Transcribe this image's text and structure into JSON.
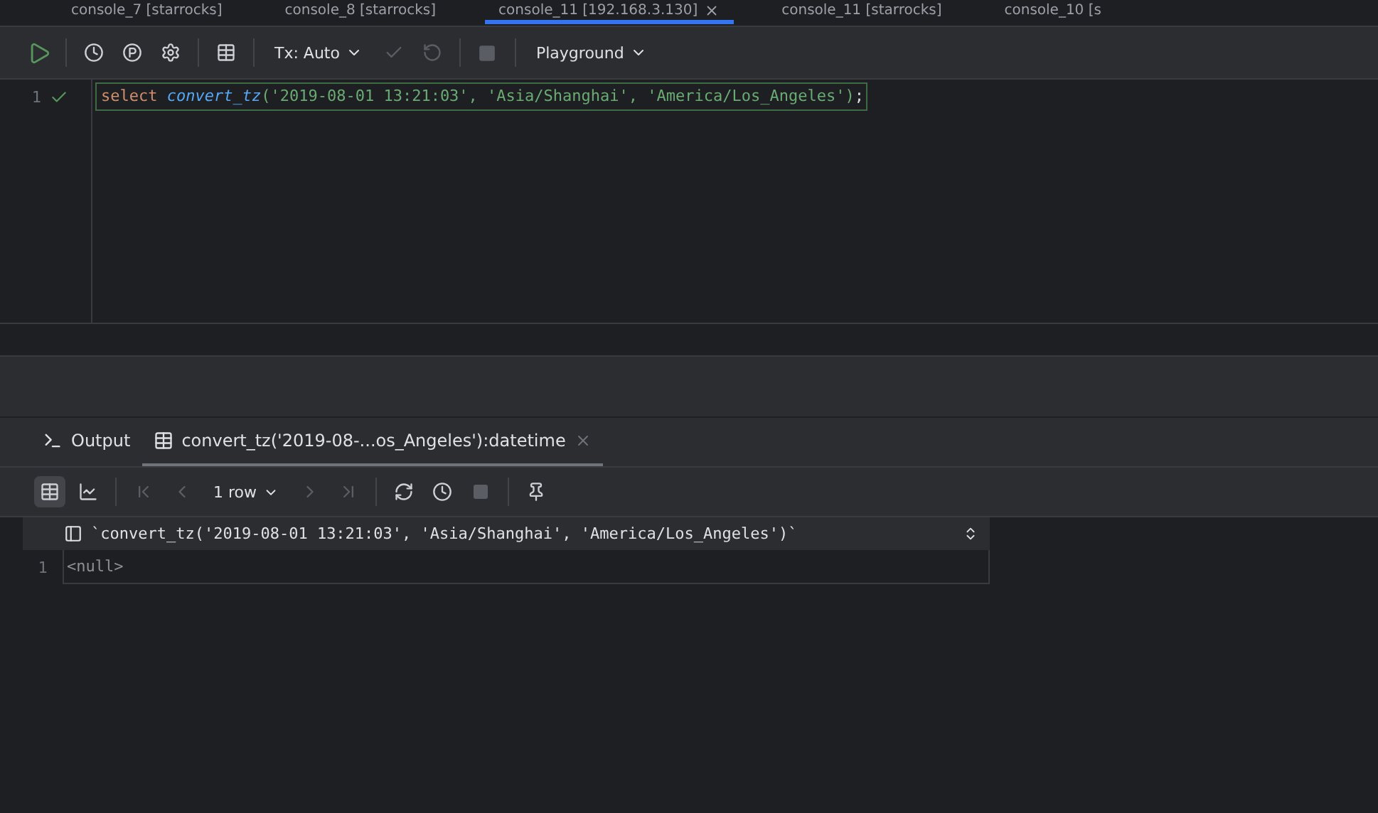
{
  "editor_tabs": [
    {
      "label": "console_7 [starrocks]",
      "selected": false
    },
    {
      "label": "console_8 [starrocks]",
      "selected": false
    },
    {
      "label": "console_11 [192.168.3.130]",
      "selected": true,
      "closable": true
    },
    {
      "label": "console_11 [starrocks]",
      "selected": false
    },
    {
      "label": "console_10 [s",
      "selected": false
    }
  ],
  "toolbar": {
    "tx_mode": "Tx: Auto",
    "schema": "Playground"
  },
  "editor": {
    "lines": [
      {
        "number": "1",
        "executed": true,
        "keyword": "select",
        "function": "convert_tz",
        "args": "('2019-08-01 13:21:03', 'Asia/Shanghai', 'America/Los_Angeles')",
        "end": ";"
      }
    ]
  },
  "result_tabs": [
    {
      "kind": "output",
      "label": "Output",
      "selected": false
    },
    {
      "kind": "table",
      "label": "convert_tz('2019-08-...os_Angeles'):datetime",
      "selected": true,
      "closable": true
    }
  ],
  "result_toolbar": {
    "views": [
      {
        "kind": "table",
        "selected": true
      },
      {
        "kind": "chart",
        "selected": false
      }
    ],
    "row_count": "1 row"
  },
  "grid": {
    "columns": [
      "`convert_tz('2019-08-01 13:21:03', 'Asia/Shanghai', 'America/Los_Angeles')`"
    ],
    "rows": [
      {
        "number": "1",
        "cells": [
          "<null>"
        ]
      }
    ]
  }
}
